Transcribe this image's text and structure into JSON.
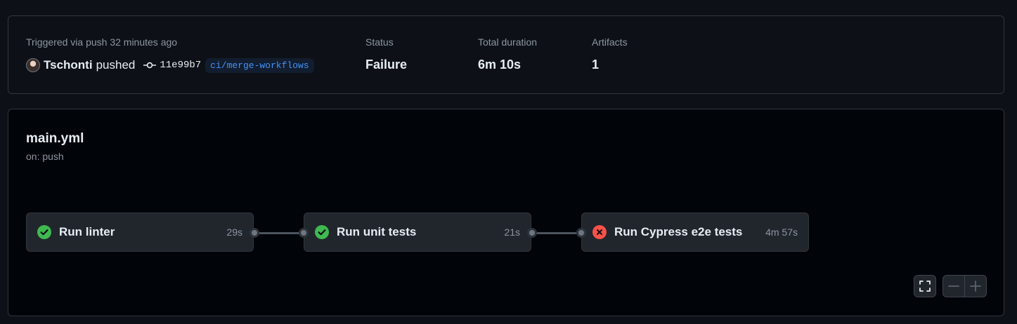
{
  "summary": {
    "trigger_label": "Triggered via push 32 minutes ago",
    "actor": "Tschonti",
    "action": "pushed",
    "commit_sha": "11e99b7",
    "branch": "ci/merge-workflows",
    "status_label": "Status",
    "status_value": "Failure",
    "duration_label": "Total duration",
    "duration_value": "6m 10s",
    "artifacts_label": "Artifacts",
    "artifacts_value": "1"
  },
  "workflow": {
    "file": "main.yml",
    "trigger": "on: push",
    "jobs": [
      {
        "name": "Run linter",
        "duration": "29s",
        "status": "success",
        "icon": "check-circle-icon"
      },
      {
        "name": "Run unit tests",
        "duration": "21s",
        "status": "success",
        "icon": "check-circle-icon"
      },
      {
        "name": "Run Cypress e2e tests",
        "duration": "4m 57s",
        "status": "failure",
        "icon": "x-circle-icon"
      }
    ]
  },
  "controls": {
    "fullscreen_icon": "fullscreen-icon",
    "zoom_out_icon": "minus-icon",
    "zoom_in_icon": "plus-icon"
  },
  "colors": {
    "success": "#3fb950",
    "failure": "#f85149",
    "link": "#4493f8",
    "muted": "#8d96a0"
  }
}
